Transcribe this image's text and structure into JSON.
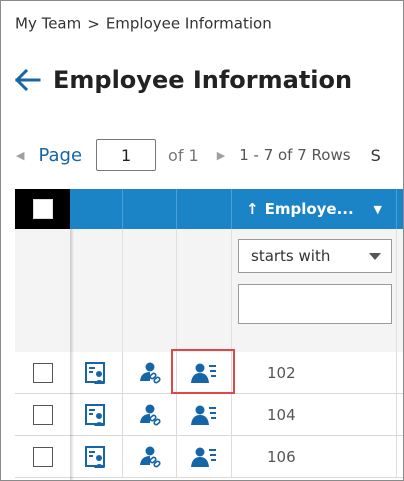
{
  "breadcrumb": {
    "parent": "My Team",
    "separator": ">",
    "current": "Employee Information"
  },
  "page": {
    "title": "Employee Information"
  },
  "pager": {
    "label": "Page",
    "current_page": "1",
    "of_text": "of 1",
    "rows_text": "1 - 7 of 7 Rows",
    "truncated_label": "S"
  },
  "grid": {
    "column_header": {
      "sort_arrow": "↑",
      "label": "Employe..."
    },
    "filter": {
      "operator": "starts with",
      "value": ""
    },
    "rows": [
      {
        "employee": "102"
      },
      {
        "employee": "104"
      },
      {
        "employee": "106"
      }
    ]
  },
  "colors": {
    "accent": "#1a84c7",
    "link": "#1565a8",
    "icon": "#1565a8",
    "highlight": "#e04848"
  },
  "icons": [
    "back-arrow-icon",
    "chevron-left-icon",
    "chevron-right-icon",
    "caret-down-icon",
    "employee-card-icon",
    "person-link-icon",
    "person-details-icon"
  ]
}
